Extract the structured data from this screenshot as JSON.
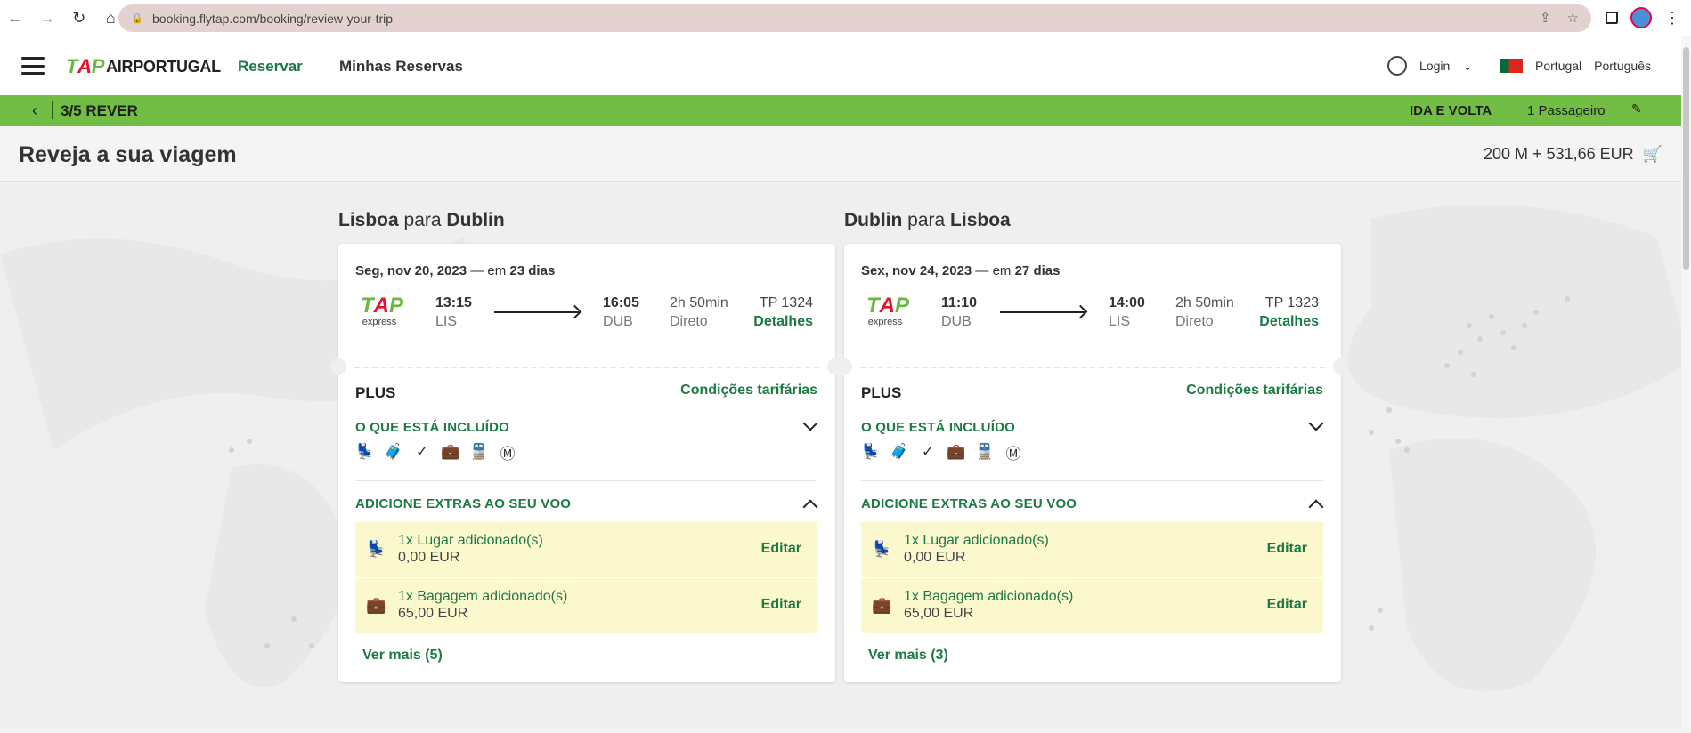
{
  "browser": {
    "url": "booking.flytap.com/booking/review-your-trip"
  },
  "header": {
    "logo_text": "AIRPORTUGAL",
    "nav": [
      "Reservar",
      "Minhas Reservas"
    ],
    "login": "Login",
    "country": "Portugal",
    "language": "Português"
  },
  "stepbar": {
    "step": "3/5 REVER",
    "trip_type": "IDA E VOLTA",
    "passengers": "1 Passageiro"
  },
  "title": {
    "text": "Reveja a sua viagem",
    "cart_total": "200 M + 531,66 EUR"
  },
  "flights": [
    {
      "origin": "Lisboa",
      "connector": "para",
      "destination": "Dublin",
      "date": "Seg, nov 20, 2023",
      "date_sep": " — em ",
      "days": "23 dias",
      "carrier_logo": "TAP",
      "carrier_sub": "express",
      "dep_time": "13:15",
      "dep_airport": "LIS",
      "arr_time": "16:05",
      "arr_airport": "DUB",
      "duration": "2h 50min",
      "stops": "Direto",
      "flight_no": "TP 1324",
      "details": "Detalhes",
      "fare": "PLUS",
      "conditions": "Condições tarifárias",
      "included_title": "O QUE ESTÁ INCLUÍDO",
      "included_icons": [
        "seat-icon",
        "baggage-icon",
        "checkin-icon",
        "suitcase-icon",
        "transport-icon",
        "miles-icon"
      ],
      "extras_title": "ADICIONE EXTRAS AO SEU VOO",
      "extras": [
        {
          "icon": "seat-icon",
          "label": "1x Lugar adicionado(s)",
          "price": "0,00 EUR",
          "action": "Editar"
        },
        {
          "icon": "suitcase-icon",
          "label": "1x Bagagem adicionado(s)",
          "price": "65,00 EUR",
          "action": "Editar"
        }
      ],
      "more": "Ver mais (5)"
    },
    {
      "origin": "Dublin",
      "connector": "para",
      "destination": "Lisboa",
      "date": "Sex, nov 24, 2023",
      "date_sep": " — em ",
      "days": "27 dias",
      "carrier_logo": "TAP",
      "carrier_sub": "express",
      "dep_time": "11:10",
      "dep_airport": "DUB",
      "arr_time": "14:00",
      "arr_airport": "LIS",
      "duration": "2h 50min",
      "stops": "Direto",
      "flight_no": "TP 1323",
      "details": "Detalhes",
      "fare": "PLUS",
      "conditions": "Condições tarifárias",
      "included_title": "O QUE ESTÁ INCLUÍDO",
      "included_icons": [
        "seat-icon",
        "baggage-icon",
        "checkin-icon",
        "suitcase-icon",
        "transport-icon",
        "miles-icon"
      ],
      "extras_title": "ADICIONE EXTRAS AO SEU VOO",
      "extras": [
        {
          "icon": "seat-icon",
          "label": "1x Lugar adicionado(s)",
          "price": "0,00 EUR",
          "action": "Editar"
        },
        {
          "icon": "suitcase-icon",
          "label": "1x Bagagem adicionado(s)",
          "price": "65,00 EUR",
          "action": "Editar"
        }
      ],
      "more": "Ver mais (3)"
    }
  ],
  "colors": {
    "brand_green": "#72be44",
    "link_green": "#1c7a45",
    "extra_bg": "#fcf8cd"
  }
}
